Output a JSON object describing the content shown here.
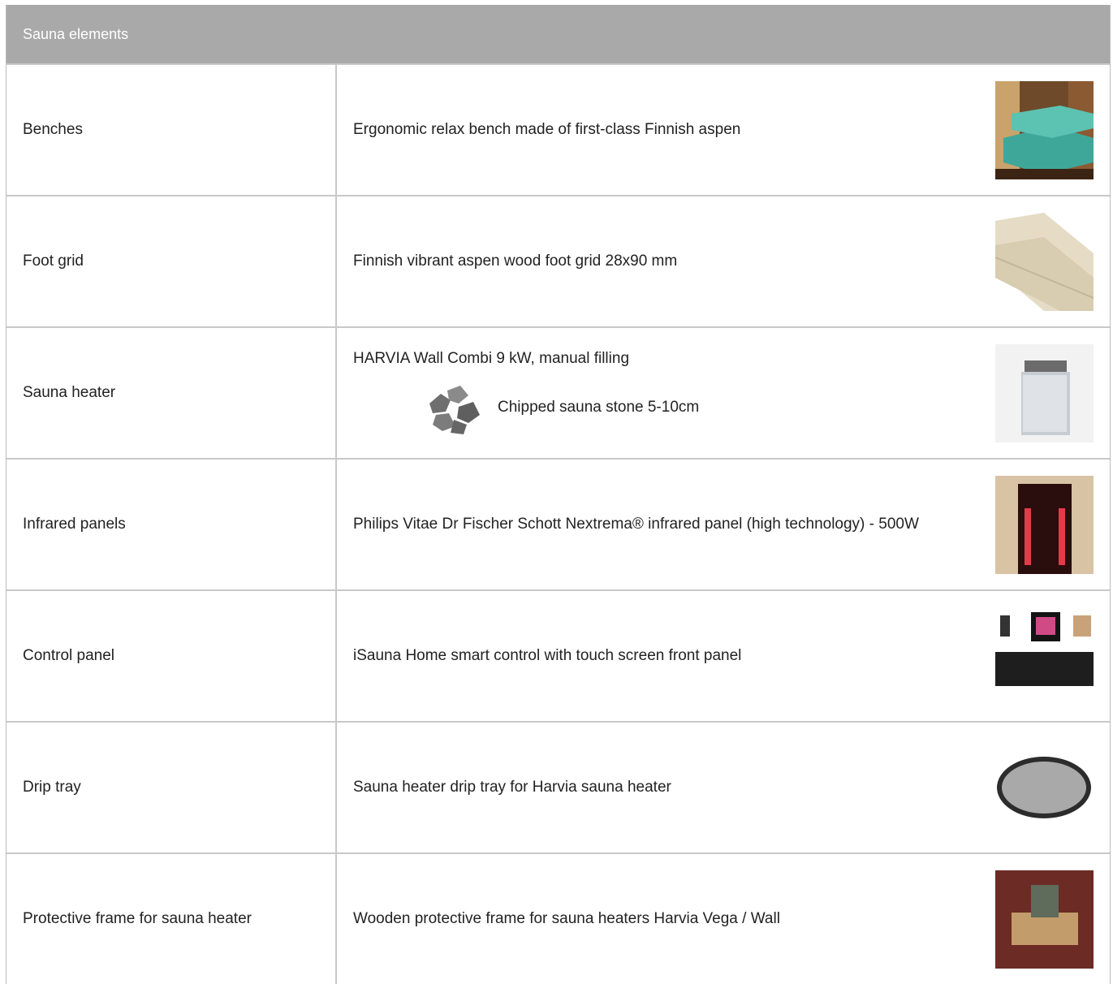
{
  "table": {
    "header": "Sauna elements",
    "rows": [
      {
        "name": "Benches",
        "desc": "Ergonomic relax bench made of first-class Finnish aspen",
        "image": "bench-image"
      },
      {
        "name": "Foot grid",
        "desc": "Finnish vibrant aspen wood foot grid 28x90 mm",
        "image": "foot-grid-image"
      },
      {
        "name": "Sauna heater",
        "desc": "HARVIA Wall Combi 9 kW, manual filling",
        "sub": "Chipped sauna stone 5-10cm",
        "image": "sauna-heater-image"
      },
      {
        "name": "Infrared panels",
        "desc": "Philips Vitae Dr Fischer Schott Nextrema® infrared panel (high technology) - 500W",
        "image": "infrared-panel-image"
      },
      {
        "name": "Control panel",
        "desc": "iSauna Home smart control with touch screen front panel",
        "image": "control-panel-image"
      },
      {
        "name": "Drip tray",
        "desc": "Sauna heater drip tray for Harvia sauna heater",
        "image": "drip-tray-image"
      },
      {
        "name": "Protective frame for sauna heater",
        "desc": "Wooden protective frame for sauna heaters Harvia Vega / Wall",
        "image": "protective-frame-image"
      }
    ]
  }
}
